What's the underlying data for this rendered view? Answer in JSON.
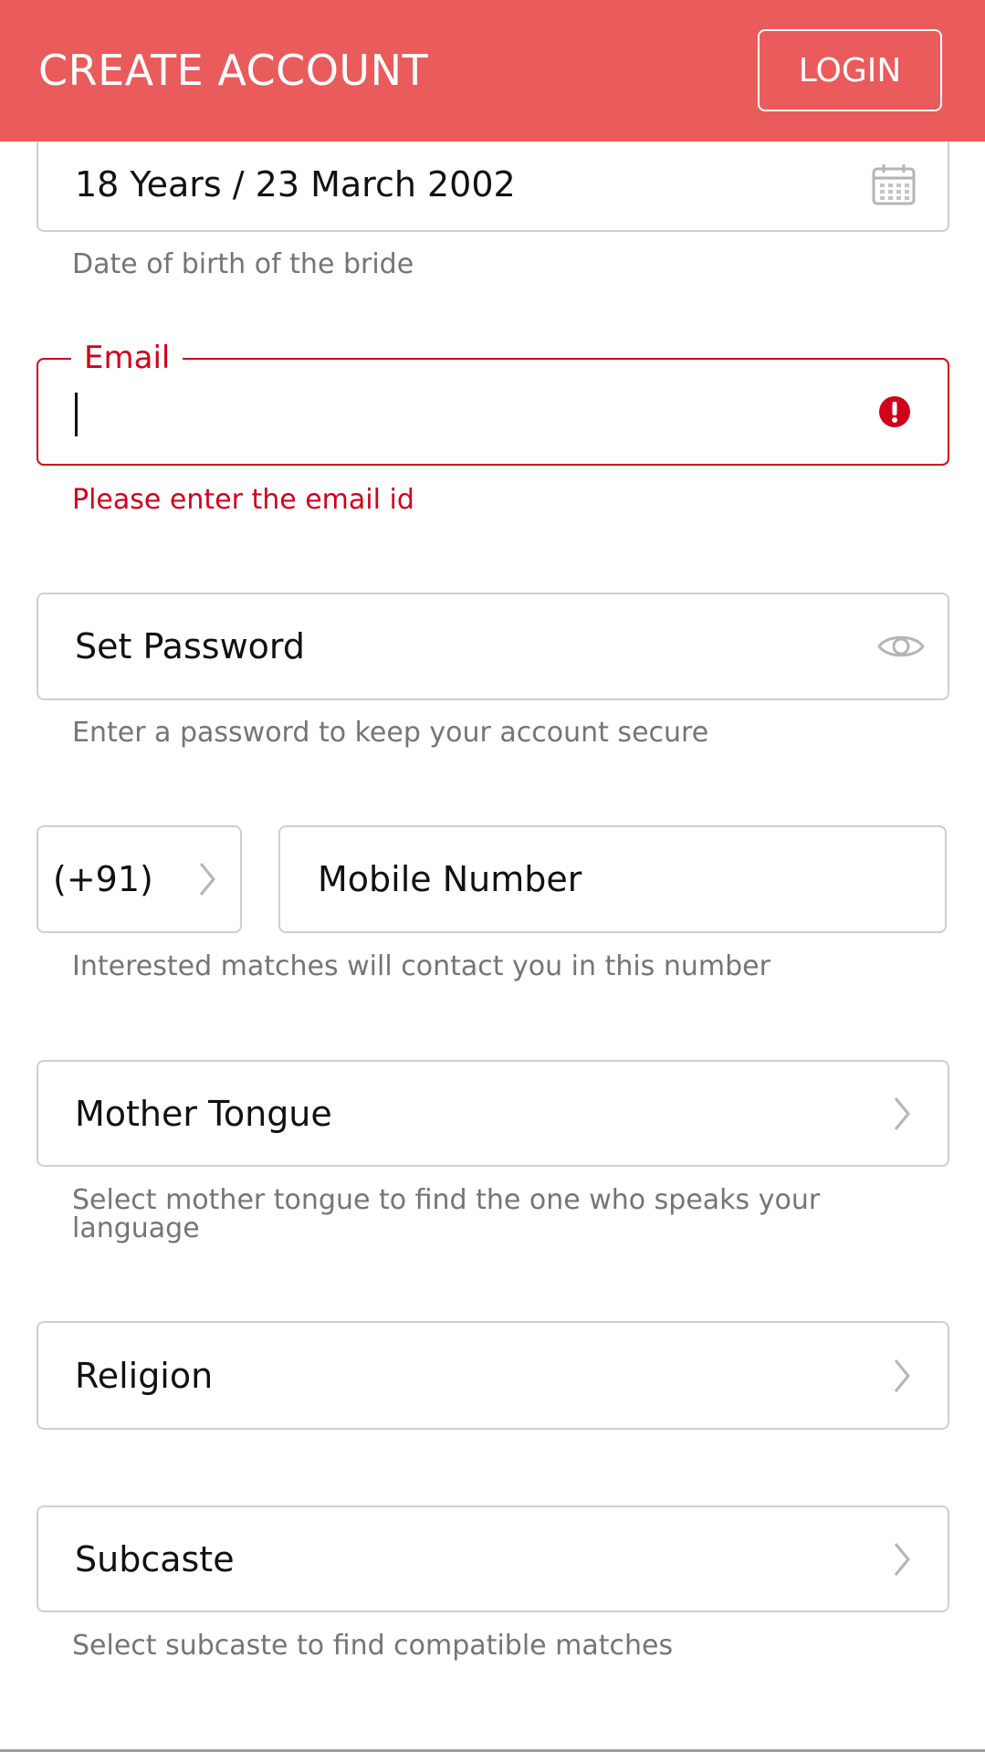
{
  "header": {
    "title": "CREATE ACCOUNT",
    "login_label": "LOGIN",
    "background_color": "#ea5b5c"
  },
  "dob": {
    "value": "18 Years / 23 March 2002",
    "helper": "Date of birth of the bride",
    "icon": "calendar-icon"
  },
  "email": {
    "label": "Email",
    "value": "",
    "error": "Please enter the email id",
    "icon": "error-icon",
    "error_color": "#d0021b"
  },
  "password": {
    "placeholder": "Set Password",
    "helper": "Enter a password to keep your account secure",
    "icon": "eye-icon"
  },
  "mobile": {
    "country_code": "(+91)",
    "placeholder": "Mobile Number",
    "helper": "Interested matches will contact you in this number"
  },
  "mother_tongue": {
    "placeholder": "Mother Tongue",
    "helper": "Select mother tongue to find the one who speaks your language"
  },
  "religion": {
    "placeholder": "Religion"
  },
  "subcaste": {
    "placeholder": "Subcaste",
    "helper": "Select subcaste to find compatible matches"
  }
}
